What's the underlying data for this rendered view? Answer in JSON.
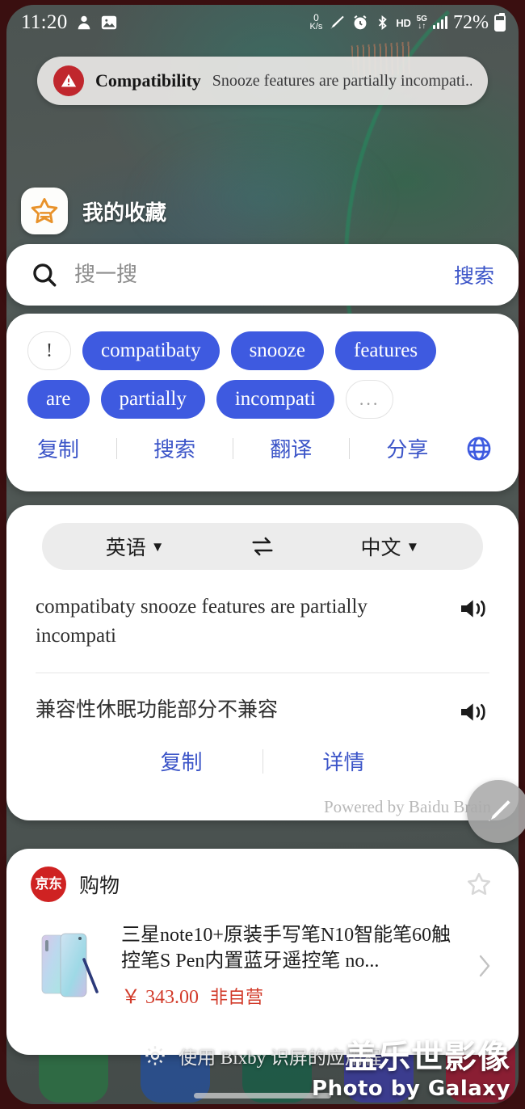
{
  "statusbar": {
    "time": "11:20",
    "left_icons": [
      "person-icon",
      "photo-icon"
    ],
    "net_speed_value": "0",
    "net_speed_unit": "K/s",
    "icons": [
      "pen-icon",
      "alarm-icon",
      "bluetooth-icon"
    ],
    "hd_label": "HD",
    "network_type": "5G",
    "network_arrows": "↓↑",
    "battery_percent": "72%"
  },
  "notification": {
    "icon": "warning-icon",
    "title": "Compatibility",
    "body": "Snooze features are partially incompati..."
  },
  "favorites": {
    "icon": "bookmark-star-icon",
    "label": "我的收藏"
  },
  "search": {
    "icon": "search-icon",
    "placeholder": "搜一搜",
    "value": "",
    "button_label": "搜索"
  },
  "chips_card": {
    "chips": [
      {
        "text": "!",
        "style": "ghost"
      },
      {
        "text": "compatibaty",
        "style": "solid"
      },
      {
        "text": "snooze",
        "style": "solid"
      },
      {
        "text": "features",
        "style": "solid"
      },
      {
        "text": "are",
        "style": "solid"
      },
      {
        "text": "partially",
        "style": "solid"
      },
      {
        "text": "incompati",
        "style": "solid"
      },
      {
        "text": "...",
        "style": "ghost"
      }
    ],
    "actions": [
      "复制",
      "搜索",
      "翻译",
      "分享"
    ],
    "globe_icon": "globe-icon"
  },
  "translate": {
    "source_lang": "英语",
    "target_lang": "中文",
    "swap_icon": "swap-arrows-icon",
    "source_text": "compatibaty snooze features are partially incompati",
    "target_text": "兼容性休眠功能部分不兼容",
    "speaker_icon": "speaker-icon",
    "actions": [
      "复制",
      "详情"
    ],
    "powered_by": "Powered by Baidu Brain"
  },
  "shopping": {
    "store_logo_text": "京东",
    "category": "购物",
    "favorite_icon": "star-outline-icon",
    "product": {
      "title": "三星note10+原装手写笔N10智能笔60触控笔S Pen内置蓝牙遥控笔 no...",
      "price": "￥ 343.00",
      "tag": "非自营",
      "thumb": "samsung-note10-product-image"
    },
    "chevron_icon": "chevron-right-icon"
  },
  "fab": {
    "icon": "pencil-icon"
  },
  "bixby_bar": {
    "icon": "gear-icon",
    "text": "使用 Bixby 识屏的应用程"
  },
  "watermark": {
    "line1": "盖乐世影像",
    "line2": "Photo by Galaxy"
  },
  "colors": {
    "chip_blue": "#3e5ae0",
    "action_blue": "#3c55c8",
    "warning_red": "#c0272d",
    "price_red": "#d23b2a",
    "jd_red": "#cf2222",
    "star_orange": "#e8922a"
  }
}
